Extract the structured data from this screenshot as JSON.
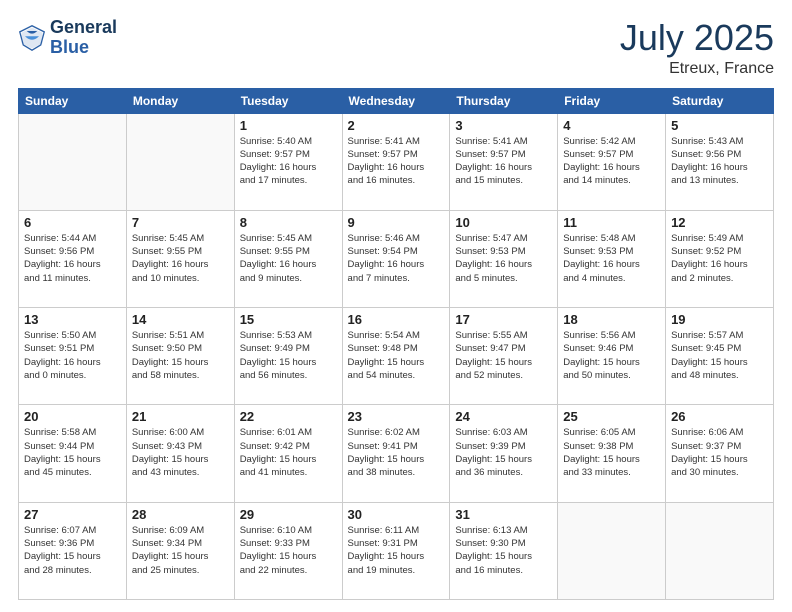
{
  "header": {
    "logo_line1": "General",
    "logo_line2": "Blue",
    "month": "July 2025",
    "location": "Etreux, France"
  },
  "weekdays": [
    "Sunday",
    "Monday",
    "Tuesday",
    "Wednesday",
    "Thursday",
    "Friday",
    "Saturday"
  ],
  "weeks": [
    [
      {
        "day": "",
        "info": ""
      },
      {
        "day": "",
        "info": ""
      },
      {
        "day": "1",
        "info": "Sunrise: 5:40 AM\nSunset: 9:57 PM\nDaylight: 16 hours\nand 17 minutes."
      },
      {
        "day": "2",
        "info": "Sunrise: 5:41 AM\nSunset: 9:57 PM\nDaylight: 16 hours\nand 16 minutes."
      },
      {
        "day": "3",
        "info": "Sunrise: 5:41 AM\nSunset: 9:57 PM\nDaylight: 16 hours\nand 15 minutes."
      },
      {
        "day": "4",
        "info": "Sunrise: 5:42 AM\nSunset: 9:57 PM\nDaylight: 16 hours\nand 14 minutes."
      },
      {
        "day": "5",
        "info": "Sunrise: 5:43 AM\nSunset: 9:56 PM\nDaylight: 16 hours\nand 13 minutes."
      }
    ],
    [
      {
        "day": "6",
        "info": "Sunrise: 5:44 AM\nSunset: 9:56 PM\nDaylight: 16 hours\nand 11 minutes."
      },
      {
        "day": "7",
        "info": "Sunrise: 5:45 AM\nSunset: 9:55 PM\nDaylight: 16 hours\nand 10 minutes."
      },
      {
        "day": "8",
        "info": "Sunrise: 5:45 AM\nSunset: 9:55 PM\nDaylight: 16 hours\nand 9 minutes."
      },
      {
        "day": "9",
        "info": "Sunrise: 5:46 AM\nSunset: 9:54 PM\nDaylight: 16 hours\nand 7 minutes."
      },
      {
        "day": "10",
        "info": "Sunrise: 5:47 AM\nSunset: 9:53 PM\nDaylight: 16 hours\nand 5 minutes."
      },
      {
        "day": "11",
        "info": "Sunrise: 5:48 AM\nSunset: 9:53 PM\nDaylight: 16 hours\nand 4 minutes."
      },
      {
        "day": "12",
        "info": "Sunrise: 5:49 AM\nSunset: 9:52 PM\nDaylight: 16 hours\nand 2 minutes."
      }
    ],
    [
      {
        "day": "13",
        "info": "Sunrise: 5:50 AM\nSunset: 9:51 PM\nDaylight: 16 hours\nand 0 minutes."
      },
      {
        "day": "14",
        "info": "Sunrise: 5:51 AM\nSunset: 9:50 PM\nDaylight: 15 hours\nand 58 minutes."
      },
      {
        "day": "15",
        "info": "Sunrise: 5:53 AM\nSunset: 9:49 PM\nDaylight: 15 hours\nand 56 minutes."
      },
      {
        "day": "16",
        "info": "Sunrise: 5:54 AM\nSunset: 9:48 PM\nDaylight: 15 hours\nand 54 minutes."
      },
      {
        "day": "17",
        "info": "Sunrise: 5:55 AM\nSunset: 9:47 PM\nDaylight: 15 hours\nand 52 minutes."
      },
      {
        "day": "18",
        "info": "Sunrise: 5:56 AM\nSunset: 9:46 PM\nDaylight: 15 hours\nand 50 minutes."
      },
      {
        "day": "19",
        "info": "Sunrise: 5:57 AM\nSunset: 9:45 PM\nDaylight: 15 hours\nand 48 minutes."
      }
    ],
    [
      {
        "day": "20",
        "info": "Sunrise: 5:58 AM\nSunset: 9:44 PM\nDaylight: 15 hours\nand 45 minutes."
      },
      {
        "day": "21",
        "info": "Sunrise: 6:00 AM\nSunset: 9:43 PM\nDaylight: 15 hours\nand 43 minutes."
      },
      {
        "day": "22",
        "info": "Sunrise: 6:01 AM\nSunset: 9:42 PM\nDaylight: 15 hours\nand 41 minutes."
      },
      {
        "day": "23",
        "info": "Sunrise: 6:02 AM\nSunset: 9:41 PM\nDaylight: 15 hours\nand 38 minutes."
      },
      {
        "day": "24",
        "info": "Sunrise: 6:03 AM\nSunset: 9:39 PM\nDaylight: 15 hours\nand 36 minutes."
      },
      {
        "day": "25",
        "info": "Sunrise: 6:05 AM\nSunset: 9:38 PM\nDaylight: 15 hours\nand 33 minutes."
      },
      {
        "day": "26",
        "info": "Sunrise: 6:06 AM\nSunset: 9:37 PM\nDaylight: 15 hours\nand 30 minutes."
      }
    ],
    [
      {
        "day": "27",
        "info": "Sunrise: 6:07 AM\nSunset: 9:36 PM\nDaylight: 15 hours\nand 28 minutes."
      },
      {
        "day": "28",
        "info": "Sunrise: 6:09 AM\nSunset: 9:34 PM\nDaylight: 15 hours\nand 25 minutes."
      },
      {
        "day": "29",
        "info": "Sunrise: 6:10 AM\nSunset: 9:33 PM\nDaylight: 15 hours\nand 22 minutes."
      },
      {
        "day": "30",
        "info": "Sunrise: 6:11 AM\nSunset: 9:31 PM\nDaylight: 15 hours\nand 19 minutes."
      },
      {
        "day": "31",
        "info": "Sunrise: 6:13 AM\nSunset: 9:30 PM\nDaylight: 15 hours\nand 16 minutes."
      },
      {
        "day": "",
        "info": ""
      },
      {
        "day": "",
        "info": ""
      }
    ]
  ]
}
